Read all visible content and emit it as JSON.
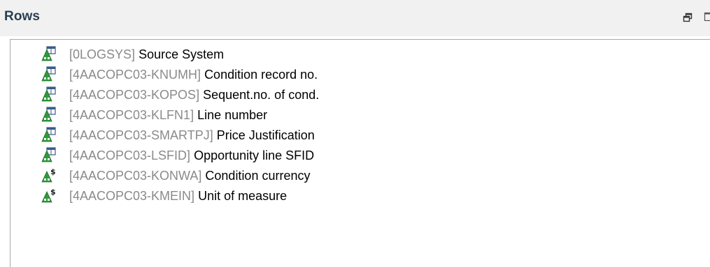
{
  "panel": {
    "title": "Rows",
    "header_icons": [
      "restore-icon",
      "maximize-icon"
    ]
  },
  "rows": [
    {
      "tech": "[0LOGSYS]",
      "desc": "Source System",
      "icon": "characteristic-icon"
    },
    {
      "tech": "[4AACOPC03-KNUMH]",
      "desc": "Condition record no.",
      "icon": "characteristic-icon"
    },
    {
      "tech": "[4AACOPC03-KOPOS]",
      "desc": "Sequent.no. of cond.",
      "icon": "characteristic-icon"
    },
    {
      "tech": "[4AACOPC03-KLFN1]",
      "desc": "Line number",
      "icon": "characteristic-icon"
    },
    {
      "tech": "[4AACOPC03-SMARTPJ]",
      "desc": "Price Justification",
      "icon": "characteristic-icon"
    },
    {
      "tech": "[4AACOPC03-LSFID]",
      "desc": "Opportunity line SFID",
      "icon": "characteristic-icon"
    },
    {
      "tech": "[4AACOPC03-KONWA]",
      "desc": "Condition currency",
      "icon": "currency-unit-icon"
    },
    {
      "tech": "[4AACOPC03-KMEIN]",
      "desc": "Unit of measure",
      "icon": "currency-unit-icon"
    }
  ],
  "colors": {
    "header_bg": "#f1f1f1",
    "title": "#2c3e50",
    "tech_name": "#8a8a8a",
    "description": "#000000",
    "icon_green": "#2e9a3c",
    "icon_blue": "#3a5a8c"
  }
}
